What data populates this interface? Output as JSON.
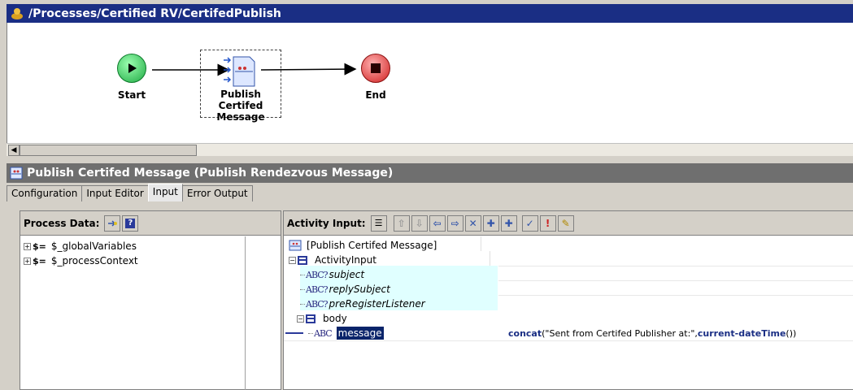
{
  "process_window": {
    "title": "/Processes/Certified RV/CertifedPublish",
    "nodes": {
      "start": "Start",
      "activity_line1": "Publish Certifed",
      "activity_line2": "Message",
      "end": "End"
    }
  },
  "activity_panel": {
    "title": "Publish Certifed Message (Publish Rendezvous Message)",
    "tabs": [
      "Configuration",
      "Input Editor",
      "Input",
      "Error Output"
    ],
    "active_tab": "Input"
  },
  "process_data": {
    "header": "Process Data:",
    "items": [
      "$_globalVariables",
      "$_processContext"
    ]
  },
  "activity_input": {
    "header": "Activity Input:",
    "root": "[Publish Certifed Message]",
    "activity_input_node": "ActivityInput",
    "fields": [
      "subject",
      "replySubject",
      "preRegisterListener"
    ],
    "body_node": "body",
    "message_node": "message",
    "message_expr_fn": "concat",
    "message_expr_arg": "(\"Sent from Certifed Publisher at:\",",
    "message_expr_fn2": "current-dateTime",
    "message_expr_tail": "())"
  },
  "colors": {
    "title_active": "#1a2e84",
    "title_inactive": "#6f6f6f",
    "field_highlight": "#e0ffff",
    "selection": "#0a246a",
    "start_green": "#2ecc55",
    "end_red": "#e03030"
  }
}
